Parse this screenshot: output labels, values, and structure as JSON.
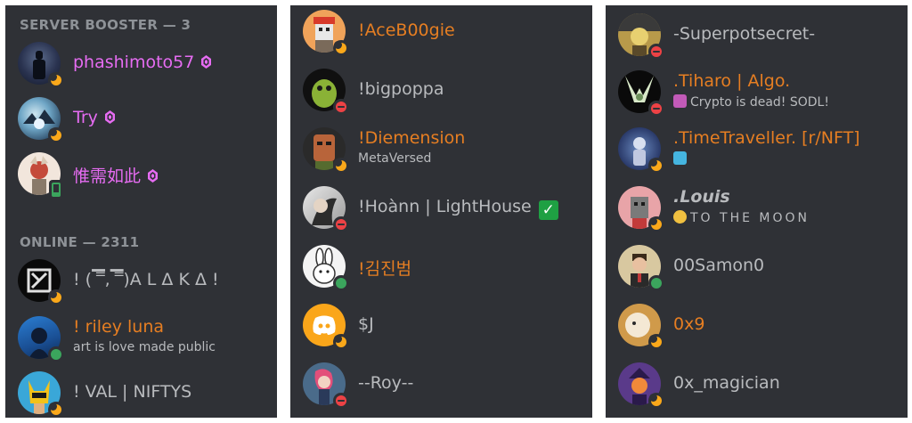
{
  "panel1": {
    "booster_header": "SERVER BOOSTER — 3",
    "online_header": "ONLINE — 2311",
    "members": [
      {
        "name": "phashimoto57"
      },
      {
        "name": "Try"
      },
      {
        "name": "惟需如此"
      },
      {
        "name": "! (▔̿,▔̿)A L Δ K Δ !"
      },
      {
        "name": "! riley luna",
        "status_text": "art is love made public"
      },
      {
        "name": "! VAL | NIFTYS"
      }
    ]
  },
  "panel2": {
    "members": [
      {
        "name": "!AceB00gie"
      },
      {
        "name": "!bigpoppa"
      },
      {
        "name": "!Diemension",
        "status_text": "MetaVersed"
      },
      {
        "name": "!Hoànn | LightHouse",
        "badge": "✓"
      },
      {
        "name": "!김진범"
      },
      {
        "name": "$J"
      },
      {
        "name": "--Roy--"
      }
    ]
  },
  "panel3": {
    "members": [
      {
        "name": "-Superpotsecret-"
      },
      {
        "name": ".Tiharo | Algo.",
        "status_text": "Crypto is dead! SODL!"
      },
      {
        "name": ".TimeTraveller. [r/NFT]"
      },
      {
        "name": ".Louis",
        "status_text": "TO THE MOON"
      },
      {
        "name": "00Samon0"
      },
      {
        "name": "0x9"
      },
      {
        "name": "0x_magician"
      }
    ]
  },
  "colors": {
    "panel_bg": "#2f3136",
    "booster_pink": "#e66cf2",
    "name_orange": "#e67e22",
    "name_grey": "#b9bbbe",
    "online": "#3ba55d",
    "dnd": "#ed4245",
    "idle": "#faa81a"
  }
}
